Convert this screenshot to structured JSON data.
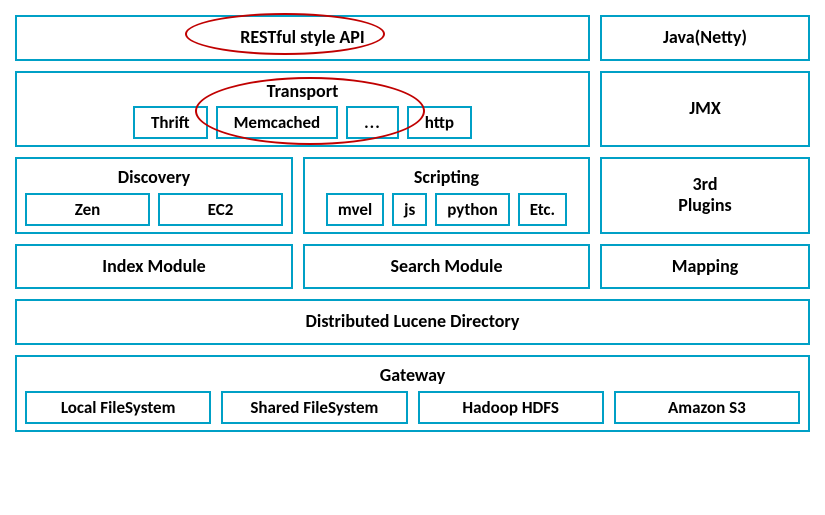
{
  "row1": {
    "restful": "RESTful style API",
    "java_netty": "Java(Netty)"
  },
  "row2": {
    "transport": {
      "title": "Transport",
      "items": [
        "Thrift",
        "Memcached",
        "...",
        "http"
      ]
    },
    "jmx": "JMX"
  },
  "row3": {
    "discovery": {
      "title": "Discovery",
      "items": [
        "Zen",
        "EC2"
      ]
    },
    "scripting": {
      "title": "Scripting",
      "items": [
        "mvel",
        "js",
        "python",
        "Etc."
      ]
    },
    "plugins": "3rd\nPlugins"
  },
  "row4": {
    "index_module": "Index Module",
    "search_module": "Search Module",
    "mapping": "Mapping"
  },
  "row5": {
    "dld": "Distributed Lucene Directory"
  },
  "row6": {
    "gateway": {
      "title": "Gateway",
      "items": [
        "Local FileSystem",
        "Shared FileSystem",
        "Hadoop HDFS",
        "Amazon S3"
      ]
    }
  },
  "highlights": [
    "RESTful style API",
    "Transport / Memcached"
  ]
}
